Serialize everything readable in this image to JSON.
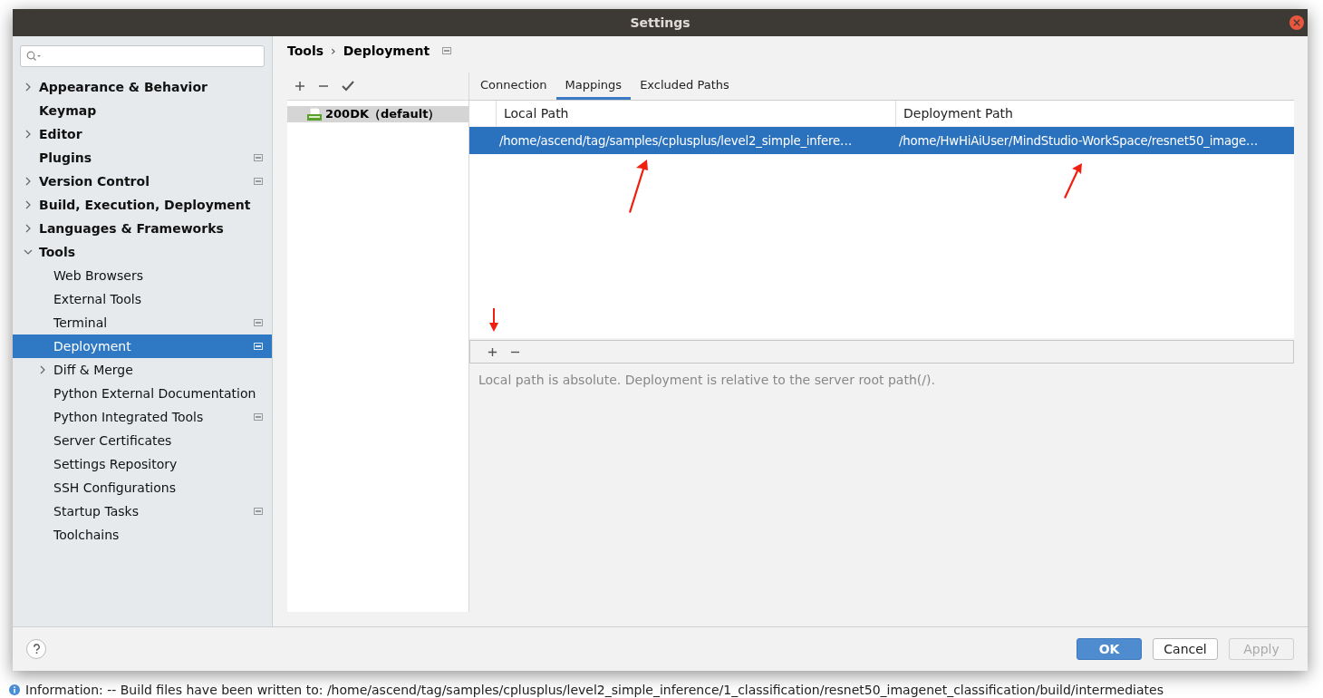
{
  "background": {
    "log": [
      {
        "text": "Information: -- Build files have been written to: /home/ascend/tag/samples/cplusplus/level2_simple_inference/1_classification/resnet50_imagenet_classification/build/intermediates"
      }
    ]
  },
  "window": {
    "title": "Settings"
  },
  "sidebar": {
    "items": [
      {
        "label": "Appearance & Behavior",
        "expanded": false,
        "badge": false,
        "selected": false
      },
      {
        "label": "Keymap",
        "badge": false,
        "selected": false
      },
      {
        "label": "Editor",
        "expanded": false,
        "badge": false,
        "selected": false
      },
      {
        "label": "Plugins",
        "badge": true,
        "selected": false
      },
      {
        "label": "Version Control",
        "expanded": false,
        "badge": true,
        "selected": false
      },
      {
        "label": "Build, Execution, Deployment",
        "expanded": false,
        "badge": false,
        "selected": false
      },
      {
        "label": "Languages & Frameworks",
        "expanded": false,
        "badge": false,
        "selected": false
      },
      {
        "label": "Tools",
        "expanded": true,
        "badge": false,
        "selected": false,
        "children": [
          {
            "label": "Web Browsers",
            "badge": false,
            "selected": false
          },
          {
            "label": "External Tools",
            "badge": false,
            "selected": false
          },
          {
            "label": "Terminal",
            "badge": true,
            "selected": false
          },
          {
            "label": "Deployment",
            "badge": true,
            "selected": true
          },
          {
            "label": "Diff & Merge",
            "expanded": false,
            "badge": false,
            "selected": false
          },
          {
            "label": "Python External Documentation",
            "badge": false,
            "selected": false
          },
          {
            "label": "Python Integrated Tools",
            "badge": true,
            "selected": false
          },
          {
            "label": "Server Certificates",
            "badge": false,
            "selected": false
          },
          {
            "label": "Settings Repository",
            "badge": false,
            "selected": false
          },
          {
            "label": "SSH Configurations",
            "badge": false,
            "selected": false
          },
          {
            "label": "Startup Tasks",
            "badge": true,
            "selected": false
          },
          {
            "label": "Toolchains",
            "badge": false,
            "selected": false
          }
        ]
      }
    ]
  },
  "breadcrumb": {
    "separator": "›",
    "items": [
      "Tools",
      "Deployment"
    ]
  },
  "servers": [
    {
      "name": "200DK（default）",
      "selected": true
    }
  ],
  "tabs": [
    {
      "label": "Connection",
      "selected": false
    },
    {
      "label": "Mappings",
      "selected": true
    },
    {
      "label": "Excluded Paths",
      "selected": false
    }
  ],
  "table": {
    "columns": [
      "Local Path",
      "Deployment Path"
    ],
    "rows": [
      {
        "local_path": "/home/ascend/tag/samples/cplusplus/level2_simple_infere…",
        "deployment_path": "/home/HwHiAiUser/MindStudio-WorkSpace/resnet50_image…",
        "selected": true
      }
    ]
  },
  "hint": "Local path is absolute. Deployment is relative to the server root path(/).",
  "buttons": [
    {
      "label": "OK",
      "kind": "primary",
      "disabled": false
    },
    {
      "label": "Cancel",
      "kind": "normal",
      "disabled": false
    },
    {
      "label": "Apply",
      "kind": "normal",
      "disabled": true
    }
  ]
}
